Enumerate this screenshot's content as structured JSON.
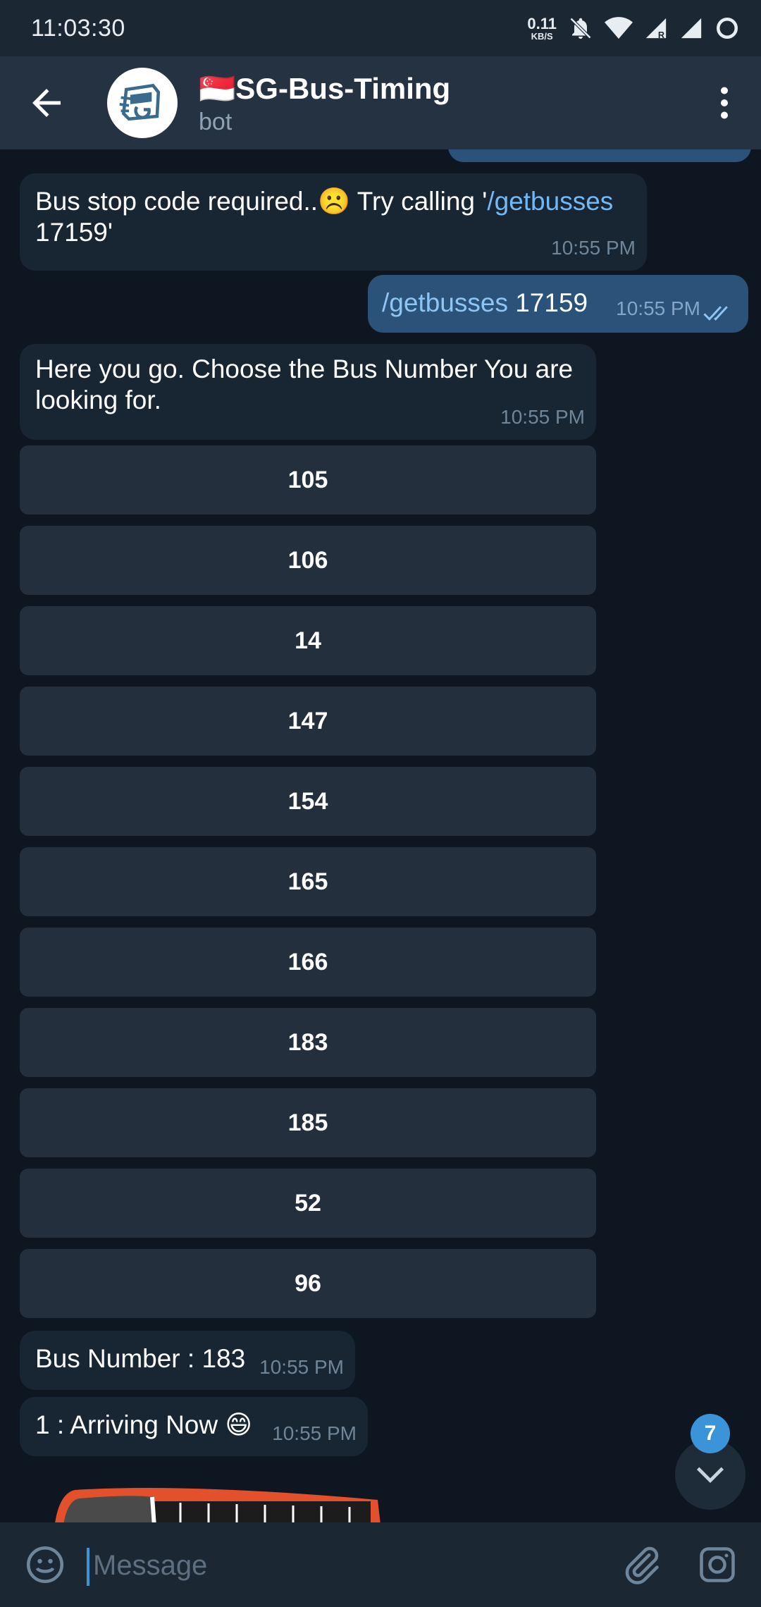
{
  "status_bar": {
    "time": "11:03:30",
    "net_speed_value": "0.11",
    "net_speed_unit": "KB/S"
  },
  "header": {
    "flag": "🇸🇬",
    "title": "SG-Bus-Timing",
    "subtitle": "bot"
  },
  "messages": {
    "m1": {
      "text_before": "Bus stop code required..",
      "emoji": "☹️",
      "text_middle": " Try calling '",
      "command": "/getbusses",
      "text_after": " 17159'",
      "time": "10:55 PM"
    },
    "m2": {
      "command": "/getbusses",
      "text": " 17159",
      "time": "10:55 PM"
    },
    "m3": {
      "text": "Here you go. Choose the Bus Number You are looking for.",
      "time": "10:55 PM"
    },
    "m4": {
      "text": "Bus Number : 183",
      "time": "10:55 PM"
    },
    "m5": {
      "text": "1 : Arriving Now ",
      "emoji": "😄",
      "time": "10:55 PM"
    }
  },
  "bus_buttons": [
    "105",
    "106",
    "14",
    "147",
    "154",
    "165",
    "166",
    "183",
    "185",
    "52",
    "96"
  ],
  "unread_count": "7",
  "composer": {
    "placeholder": "Message"
  },
  "colors": {
    "background": "#0e1621",
    "incoming_bubble": "#182533",
    "outgoing_bubble": "#2b5278",
    "accent": "#3b93d8",
    "link": "#72baf5"
  }
}
